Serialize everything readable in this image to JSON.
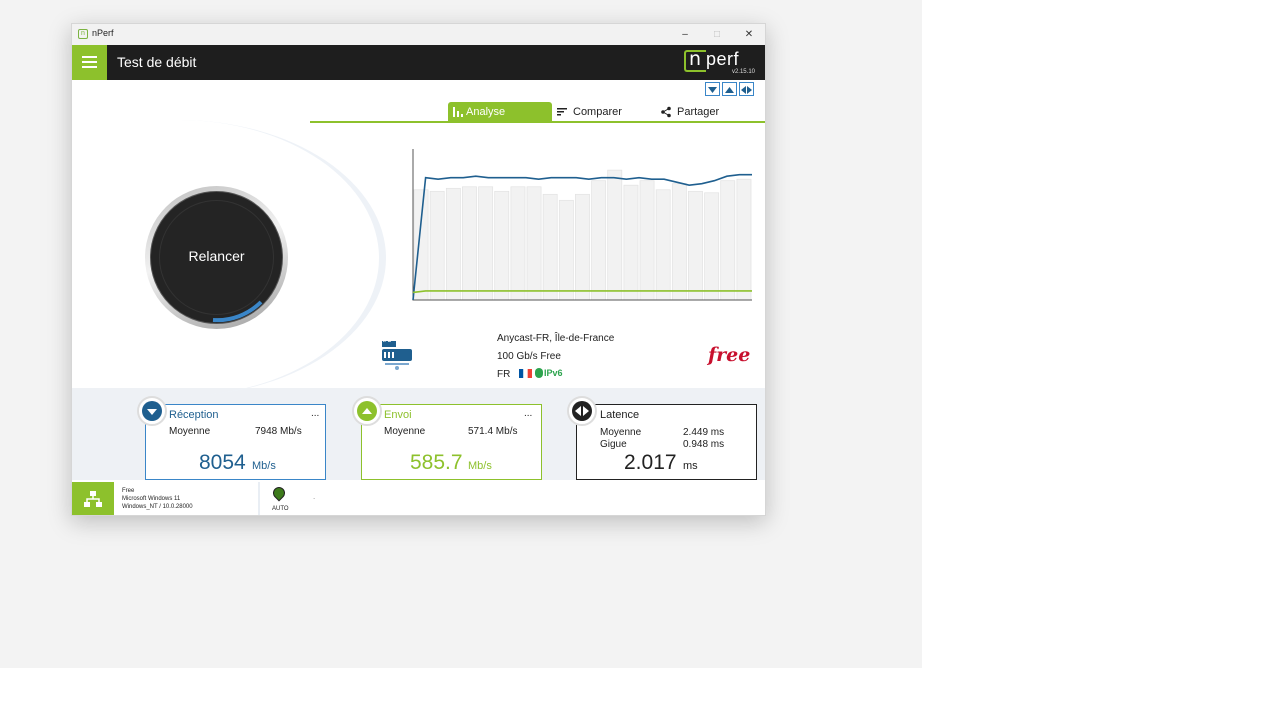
{
  "window": {
    "title": "nPerf",
    "minimize": "–",
    "maximize": "□",
    "close": "✕"
  },
  "header": {
    "title": "Test de débit",
    "logo_n": "n",
    "logo_text": "perf",
    "version": "v2.15.10"
  },
  "tabs": [
    {
      "label": "Analyse",
      "icon": "bar-chart-icon",
      "active": true
    },
    {
      "label": "Comparer",
      "icon": "compare-icon",
      "active": false
    },
    {
      "label": "Partager",
      "icon": "share-icon",
      "active": false
    }
  ],
  "start_button": {
    "label": "Relancer"
  },
  "server": {
    "name": "Anycast-FR, Île-de-France",
    "capacity": "100 Gb/s Free",
    "country": "FR",
    "ipv6": "IPv6",
    "server_icon_label": "IPS",
    "provider_logo": "free"
  },
  "cards": {
    "download": {
      "title": "Réception",
      "more": "...",
      "avg_label": "Moyenne",
      "avg_value": "7948 Mb/s",
      "value": "8054",
      "unit": "Mb/s"
    },
    "upload": {
      "title": "Envoi",
      "more": "...",
      "avg_label": "Moyenne",
      "avg_value": "571.4 Mb/s",
      "value": "585.7",
      "unit": "Mb/s"
    },
    "latency": {
      "title": "Latence",
      "avg_label": "Moyenne",
      "avg_value": "2.449 ms",
      "jitter_label": "Gigue",
      "jitter_value": "0.948 ms",
      "value": "2.017",
      "unit": "ms"
    }
  },
  "footer": {
    "isp": "Free",
    "os": "Microsoft Windows 11",
    "ua": "Windows_NT / 10.0.28000",
    "mode": "AUTO",
    "dot": "."
  },
  "colors": {
    "accent": "#8dc12c",
    "download": "#1f5f8f",
    "upload": "#8dc12c",
    "latency": "#222222",
    "bars": "#f2f2f2"
  },
  "chart_data": {
    "type": "line",
    "bars": [
      73,
      72,
      74,
      75,
      75,
      72,
      75,
      75,
      70,
      66,
      70,
      79,
      86,
      76,
      79,
      73,
      77,
      72,
      71,
      79,
      80
    ],
    "series": [
      {
        "values": [
          0,
          81,
          80,
          81,
          81,
          82,
          81,
          81,
          81,
          81,
          80,
          81,
          81,
          81,
          80,
          81,
          81,
          80,
          81,
          80,
          80,
          78,
          76,
          77,
          79,
          82,
          83,
          83
        ]
      },
      {
        "values": [
          5,
          6,
          6,
          6,
          6,
          6,
          6,
          6,
          6,
          6,
          6,
          6,
          6,
          6,
          6,
          6,
          6,
          6,
          6,
          6,
          6,
          6,
          6,
          6,
          6,
          6,
          6,
          6
        ]
      }
    ],
    "ylim": [
      0,
      100
    ]
  }
}
